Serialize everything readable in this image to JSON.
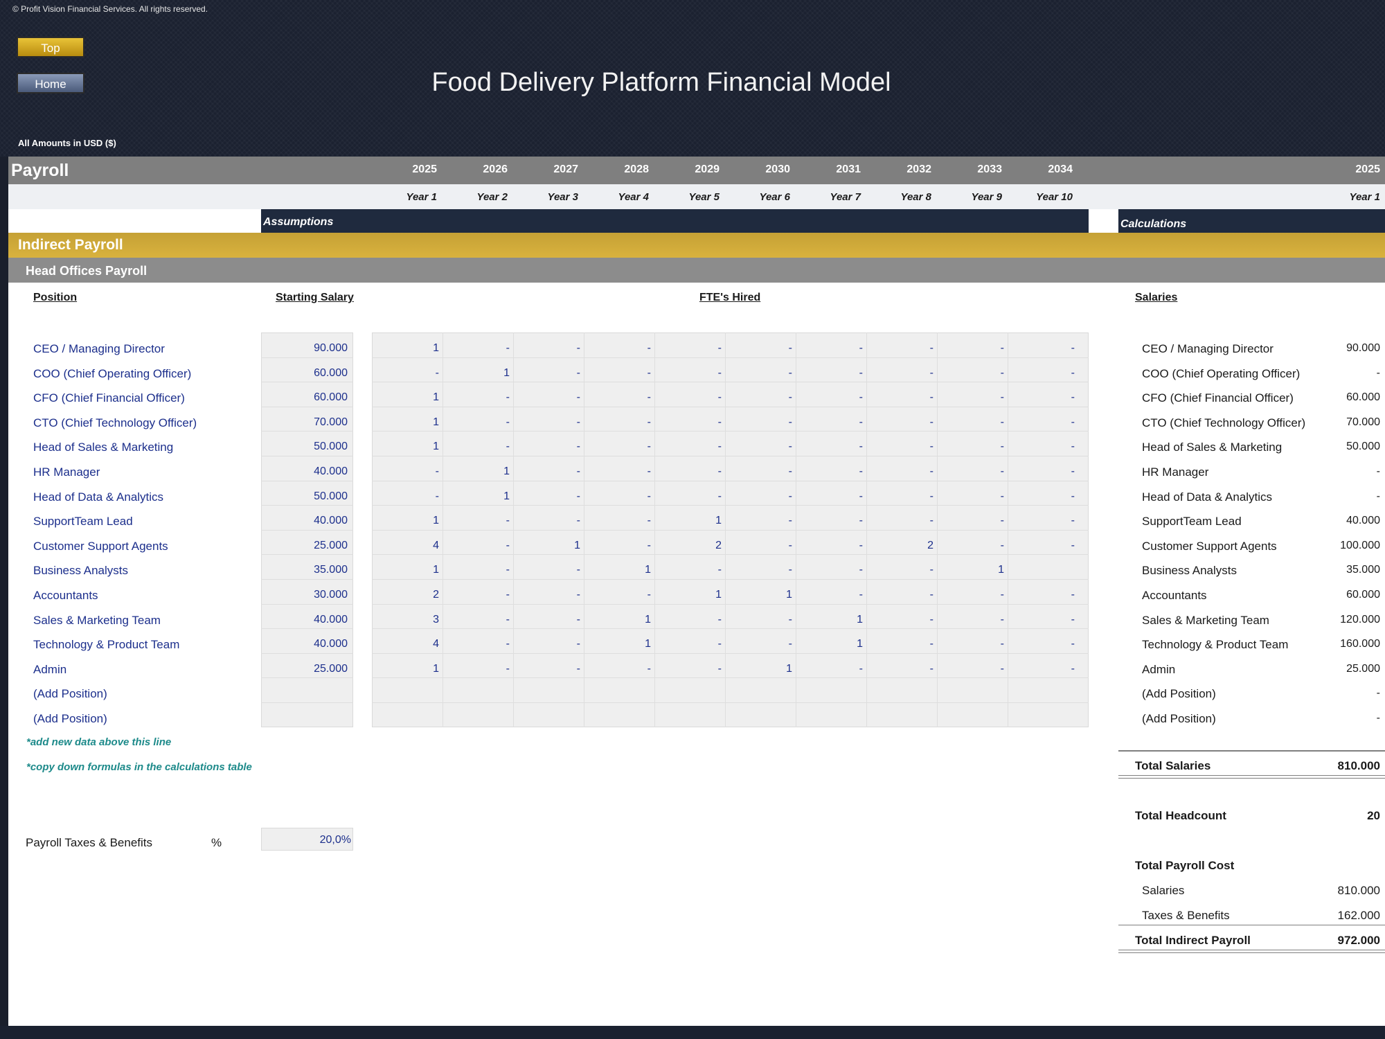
{
  "copyright": "© Profit Vision Financial Services. All rights reserved.",
  "buttons": {
    "top": "Top",
    "home": "Home"
  },
  "title": "Food Delivery Platform Financial Model",
  "currency_note": "All Amounts in  USD ($)",
  "sheet": {
    "section": "Payroll",
    "years": [
      "2025",
      "2026",
      "2027",
      "2028",
      "2029",
      "2030",
      "2031",
      "2032",
      "2033",
      "2034"
    ],
    "year_labels": [
      "Year 1",
      "Year 2",
      "Year 3",
      "Year 4",
      "Year 5",
      "Year 6",
      "Year 7",
      "Year 8",
      "Year 9",
      "Year 10"
    ],
    "calc_year": "2025",
    "calc_year_label": "Year 1",
    "assumptions_label": "Assumptions",
    "calculations_label": "Calculations",
    "indirect_payroll": "Indirect Payroll",
    "head_offices_payroll": "Head Offices Payroll",
    "col_position": "Position",
    "col_starting_salary": "Starting Salary",
    "col_fte": "FTE's Hired",
    "col_salaries": "Salaries"
  },
  "positions": [
    {
      "name": "CEO / Managing Director",
      "salary": "90.000",
      "fte": [
        "1",
        "-",
        "-",
        "-",
        "-",
        "-",
        "-",
        "-",
        "-",
        "-"
      ],
      "calc": "90.000"
    },
    {
      "name": "COO (Chief Operating Officer)",
      "salary": "60.000",
      "fte": [
        "-",
        "1",
        "-",
        "-",
        "-",
        "-",
        "-",
        "-",
        "-",
        "-"
      ],
      "calc": "-"
    },
    {
      "name": "CFO (Chief Financial Officer)",
      "salary": "60.000",
      "fte": [
        "1",
        "-",
        "-",
        "-",
        "-",
        "-",
        "-",
        "-",
        "-",
        "-"
      ],
      "calc": "60.000"
    },
    {
      "name": "CTO (Chief Technology Officer)",
      "salary": "70.000",
      "fte": [
        "1",
        "-",
        "-",
        "-",
        "-",
        "-",
        "-",
        "-",
        "-",
        "-"
      ],
      "calc": "70.000"
    },
    {
      "name": "Head of Sales & Marketing",
      "salary": "50.000",
      "fte": [
        "1",
        "-",
        "-",
        "-",
        "-",
        "-",
        "-",
        "-",
        "-",
        "-"
      ],
      "calc": "50.000"
    },
    {
      "name": "HR Manager",
      "salary": "40.000",
      "fte": [
        "-",
        "1",
        "-",
        "-",
        "-",
        "-",
        "-",
        "-",
        "-",
        "-"
      ],
      "calc": "-"
    },
    {
      "name": "Head of Data & Analytics",
      "salary": "50.000",
      "fte": [
        "-",
        "1",
        "-",
        "-",
        "-",
        "-",
        "-",
        "-",
        "-",
        "-"
      ],
      "calc": "-"
    },
    {
      "name": "SupportTeam Lead",
      "salary": "40.000",
      "fte": [
        "1",
        "-",
        "-",
        "-",
        "1",
        "-",
        "-",
        "-",
        "-",
        "-"
      ],
      "calc": "40.000"
    },
    {
      "name": "Customer Support Agents",
      "salary": "25.000",
      "fte": [
        "4",
        "-",
        "1",
        "-",
        "2",
        "-",
        "-",
        "2",
        "-",
        "-"
      ],
      "calc": "100.000"
    },
    {
      "name": "Business Analysts",
      "salary": "35.000",
      "fte": [
        "1",
        "-",
        "-",
        "1",
        "-",
        "-",
        "-",
        "-",
        "1",
        ""
      ],
      "calc": "35.000"
    },
    {
      "name": "Accountants",
      "salary": "30.000",
      "fte": [
        "2",
        "-",
        "-",
        "-",
        "1",
        "1",
        "-",
        "-",
        "-",
        "-"
      ],
      "calc": "60.000"
    },
    {
      "name": "Sales & Marketing Team",
      "salary": "40.000",
      "fte": [
        "3",
        "-",
        "-",
        "1",
        "-",
        "-",
        "1",
        "-",
        "-",
        "-"
      ],
      "calc": "120.000"
    },
    {
      "name": "Technology & Product Team",
      "salary": "40.000",
      "fte": [
        "4",
        "-",
        "-",
        "1",
        "-",
        "-",
        "1",
        "-",
        "-",
        "-"
      ],
      "calc": "160.000"
    },
    {
      "name": "Admin",
      "salary": "25.000",
      "fte": [
        "1",
        "-",
        "-",
        "-",
        "-",
        "1",
        "-",
        "-",
        "-",
        "-"
      ],
      "calc": "25.000"
    },
    {
      "name": "(Add Position)",
      "salary": "",
      "fte": [
        "",
        "",
        "",
        "",
        "",
        "",
        "",
        "",
        "",
        ""
      ],
      "calc": "-"
    },
    {
      "name": "(Add Position)",
      "salary": "",
      "fte": [
        "",
        "",
        "",
        "",
        "",
        "",
        "",
        "",
        "",
        ""
      ],
      "calc": "-"
    }
  ],
  "notes": {
    "add_data": "*add new data above this line",
    "copy_formulas": "*copy down formulas in the calculations table"
  },
  "taxes": {
    "label": "Payroll Taxes & Benefits",
    "unit": "%",
    "value": "20,0%"
  },
  "totals": {
    "total_salaries_label": "Total Salaries",
    "total_salaries": "810.000",
    "total_headcount_label": "Total Headcount",
    "total_headcount": "20",
    "total_payroll_cost_label": "Total Payroll Cost",
    "salaries_label": "Salaries",
    "salaries": "810.000",
    "taxes_label": "Taxes & Benefits",
    "taxes": "162.000",
    "total_indirect_label": "Total Indirect Payroll",
    "total_indirect": "972.000"
  }
}
